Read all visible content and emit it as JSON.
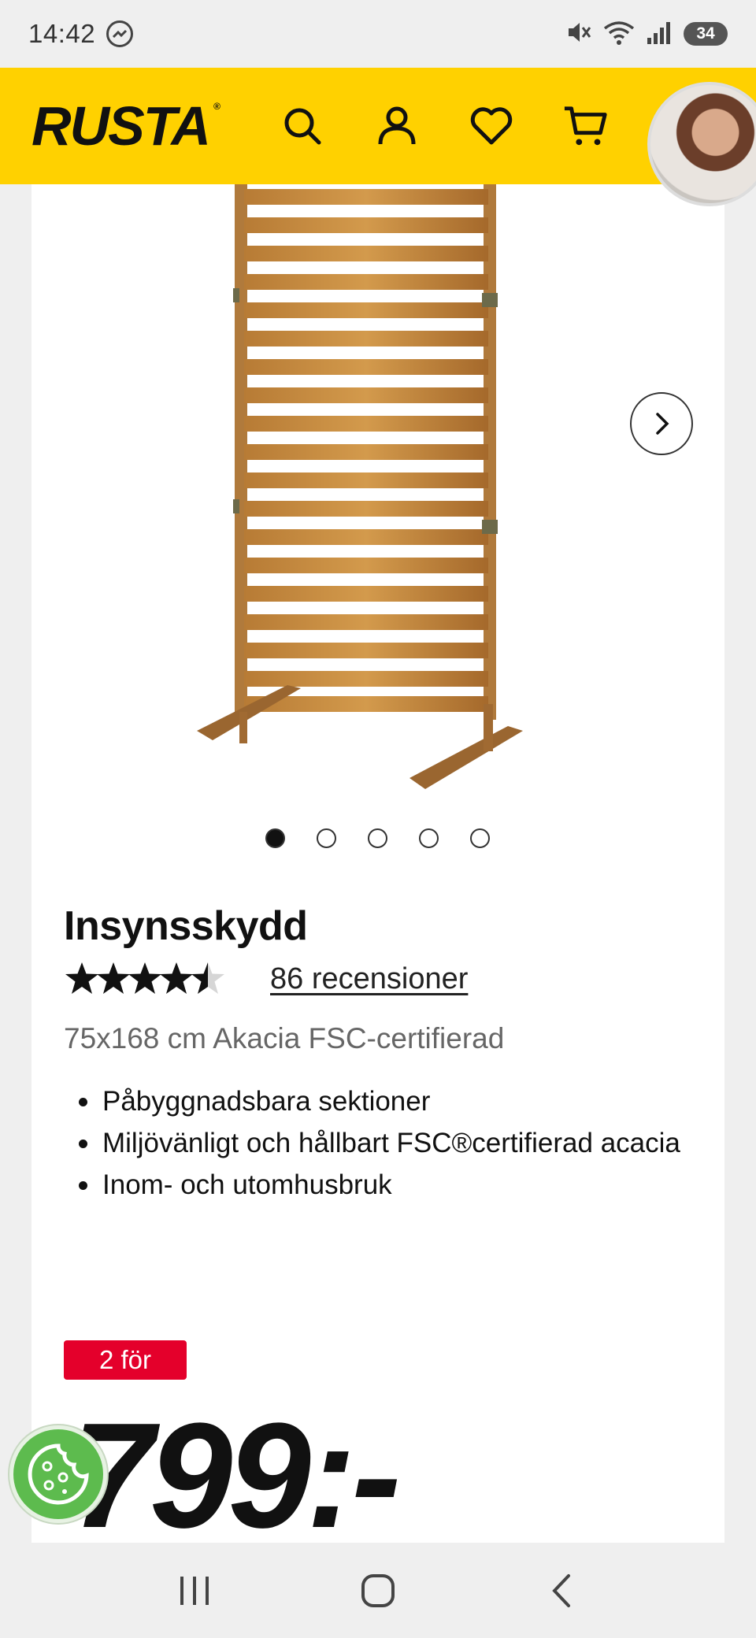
{
  "status_bar": {
    "time": "14:42",
    "battery": "34",
    "icons": [
      "messenger-icon",
      "mute-icon",
      "wifi-icon",
      "signal-icon",
      "battery-icon"
    ]
  },
  "header": {
    "logo": "RUSTA",
    "icons": [
      "search-icon",
      "account-icon",
      "heart-icon",
      "cart-icon"
    ],
    "brand_color": "#ffd100"
  },
  "gallery": {
    "dots_total": 5,
    "active_dot": 1
  },
  "product": {
    "title": "Insynsskydd",
    "rating": 4.5,
    "reviews_label": "86 recensioner",
    "subtitle": "75x168 cm Akacia FSC-certifierad",
    "bullets": [
      "Påbyggnadsbara sektioner",
      "Miljövänligt och hållbart FSC®certifierad acacia",
      "Inom- och utomhusbruk"
    ],
    "promo": "2 för",
    "price": "799:-",
    "promo_color": "#e4002b"
  },
  "nav_bar": {
    "icons": [
      "recent-apps-icon",
      "home-icon",
      "back-icon"
    ]
  }
}
